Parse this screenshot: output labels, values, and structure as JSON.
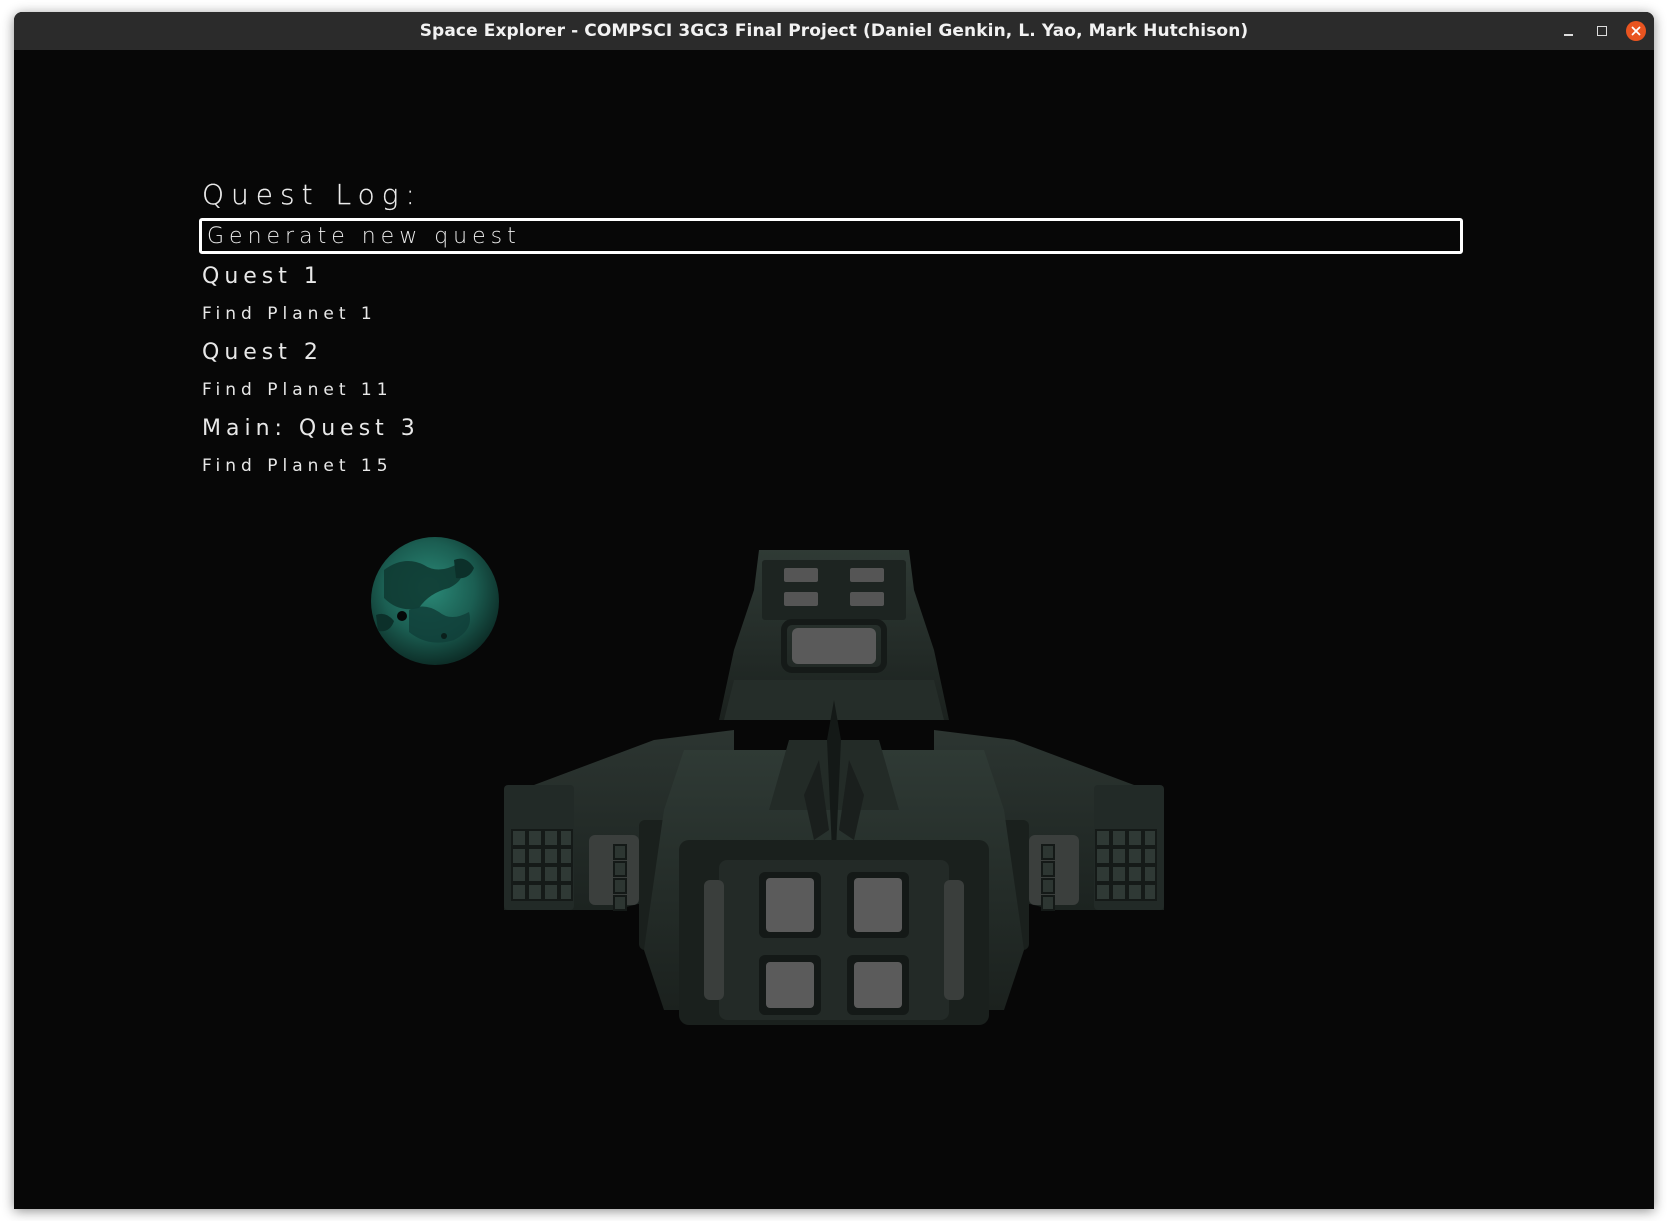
{
  "window": {
    "title": "Space Explorer - COMPSCI 3GC3 Final Project (Daniel Genkin, L. Yao, Mark Hutchison)"
  },
  "quest_log": {
    "title": "Quest Log:",
    "selected_action": "Generate new quest",
    "entries": [
      {
        "quest": "Quest 1",
        "task": "Find Planet 1"
      },
      {
        "quest": "Quest 2",
        "task": "Find Planet 11"
      },
      {
        "quest": "Main: Quest 3",
        "task": "Find Planet 15"
      }
    ]
  },
  "colors": {
    "background": "#070707",
    "titlebar": "#2b2b2b",
    "text": "#ececec",
    "close_button": "#e95420",
    "planet": "#1f6b5e",
    "ship": "#2a332f"
  }
}
